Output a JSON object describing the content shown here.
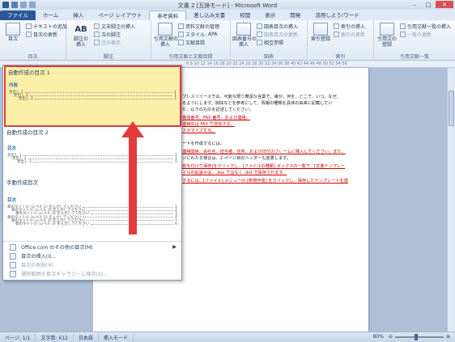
{
  "window": {
    "title": "文書 2 [互換モード] - Microsoft Word"
  },
  "tabs": [
    "ファイル",
    "ホーム",
    "挿入",
    "ページ レイアウト",
    "参考資料",
    "差し込み文書",
    "校閲",
    "表示",
    "開発",
    "活用しよう!ワード"
  ],
  "ribbon": {
    "toc": {
      "big": "目次",
      "add_text": "テキストの追加",
      "update": "目次の更新",
      "group": "目次"
    },
    "footnote": {
      "big_top": "AB",
      "big": "脚注の\n挿入",
      "endnote": "文末脚注の挿入",
      "next": "次の脚注",
      "show": "注の表示",
      "group": "脚注"
    },
    "citation": {
      "big": "引用文献の\n挿入",
      "manage": "資料文献の管理",
      "style_label": "スタイル:",
      "style_value": "APA",
      "bib": "文献目録",
      "group": "引用文献と文献目録"
    },
    "caption": {
      "big": "図表番号の\n挿入",
      "insert_figtoc": "図表目次の挿入",
      "update_figtoc": "図表目次の更新",
      "crossref": "相互参照",
      "group": "図表"
    },
    "index": {
      "big": "索引登録",
      "insert": "索引の挿入",
      "update": "索引の更新",
      "group": "索引"
    },
    "toa": {
      "big": "引用文の\n登録",
      "insert": "引用文献一覧の挿入",
      "update": "一覧の更新",
      "group": "引用文献一覧"
    }
  },
  "ruler_text": "6 8 10 12 14 16 18 20 22 24 26 28 30 32 34 36 38 40 42 44 46 48 50 52 54 56",
  "gallery": {
    "builtin_label": "自動作成の目次 1",
    "builtin_title": "内容",
    "builtin_lines": [
      "見出し 1",
      "見出し 2",
      "見出し 3"
    ],
    "builtin2_label": "自動作成の目次 2",
    "builtin2_title": "目次",
    "builtin2_lines": [
      "見出し 1",
      "見出し 2",
      "見出し 3"
    ],
    "manual_label": "手動作成目次",
    "manual_title": "目次",
    "manual_lines": [
      "章のタイトル (レベル 1) を入力してください",
      "章のタイトル (レベル 2) を入力してください",
      "章のタイトル (レベル 3) を入力してください",
      "章のタイトル (レベル 1) を入力してください",
      "章のタイトル (レベル 2) を入力してください",
      "章のタイトル (レベル 3) を入力してください"
    ],
    "menu": [
      {
        "label": "Office.com のその他の目次(M)",
        "has_arrow": true,
        "disabled": false
      },
      {
        "label": "目次の挿入(I)...",
        "has_arrow": false,
        "disabled": false
      },
      {
        "label": "目次の削除(R)",
        "has_arrow": false,
        "disabled": true
      },
      {
        "label": "選択範囲を目次ギャラリーに保存(S)...",
        "has_arrow": false,
        "disabled": true
      }
    ]
  },
  "doc_lines": [
    "プレスリリースでは、可能な限り簡潔な言葉で、誰が、何を、どこで、いつ、なぜ、",
    "るようにします。削除などを参考にして、情報の種類を具体の由来に記載してい",
    "た、以下のものを記述してください。",
    "電話番号、FAX 番号、および連絡。",
    "連絡先は FAX で送信する。",
    "スタマイズする。",
    "ートを作成するには、",
    "連絡関係、会社名、担当者、住所、および日付のフレームに挿入してください。また、",
    "ジにわたる場合は、2 ページ目のヘッダーも変更します。",
    "前を付けて保存]をクリックし、[ファイルの種類] ボックスの一覧で、[文書テンプレー",
    "イルの拡張子は、.doc ではなく .dot で保存されます。",
    "するには、[ファイル] メニューの [新規作成] をクリックし、保存したテンプレートを選"
  ],
  "status": {
    "page": "ページ: 1/1",
    "words": "文字数: 612",
    "language": "日本語",
    "mode": "挿入モード",
    "zoom": "80%"
  },
  "colors": {
    "accent": "#2b579a",
    "highlight": "#fcefa8",
    "annotation": "#e33b3b"
  }
}
